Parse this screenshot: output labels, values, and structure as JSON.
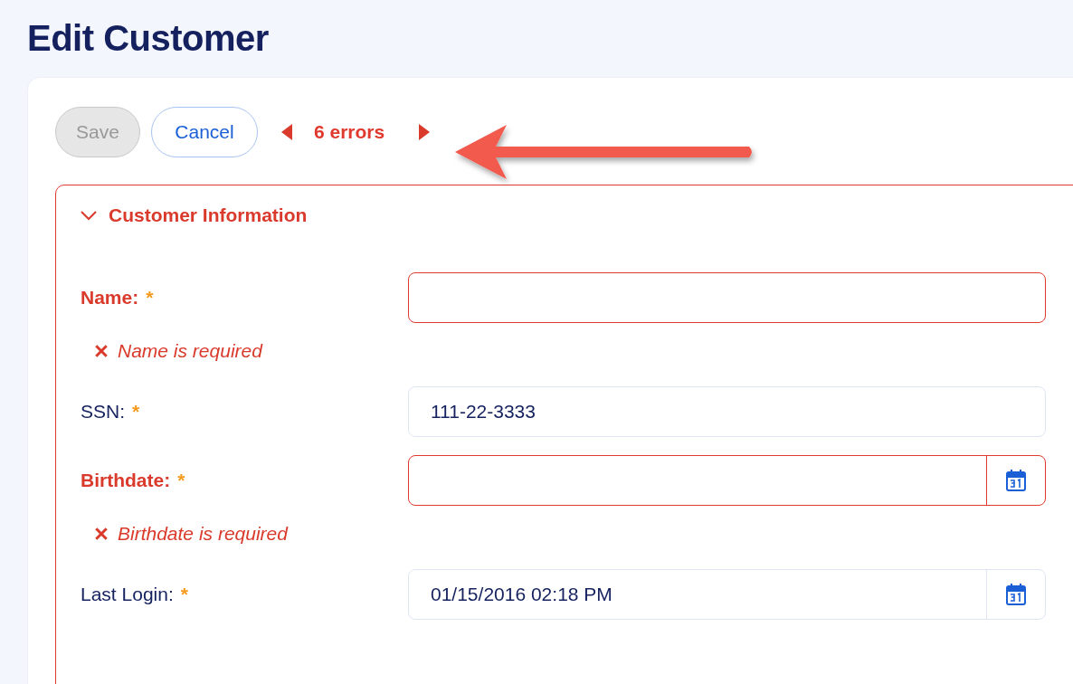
{
  "page": {
    "title": "Edit Customer"
  },
  "toolbar": {
    "buttons": [
      {
        "label": "Save",
        "disabled": true
      },
      {
        "label": "Cancel",
        "disabled": false
      }
    ],
    "error_count": "6 errors"
  },
  "section": {
    "title": "Customer Information",
    "expanded": true,
    "invalid": true,
    "fields": [
      {
        "kind": "text",
        "label": "Name:",
        "required_mark": "*",
        "invalid": true,
        "error": "Name is required"
      },
      {
        "kind": "text",
        "label": "SSN:",
        "required_mark": "*",
        "invalid": false,
        "value": "111-22-3333"
      },
      {
        "kind": "date",
        "label": "Birthdate:",
        "required_mark": "*",
        "invalid": true,
        "error": "Birthdate is required"
      },
      {
        "kind": "date",
        "label": "Last Login:",
        "required_mark": "*",
        "invalid": false,
        "value": "01/15/2016 02:18 PM"
      }
    ]
  }
}
